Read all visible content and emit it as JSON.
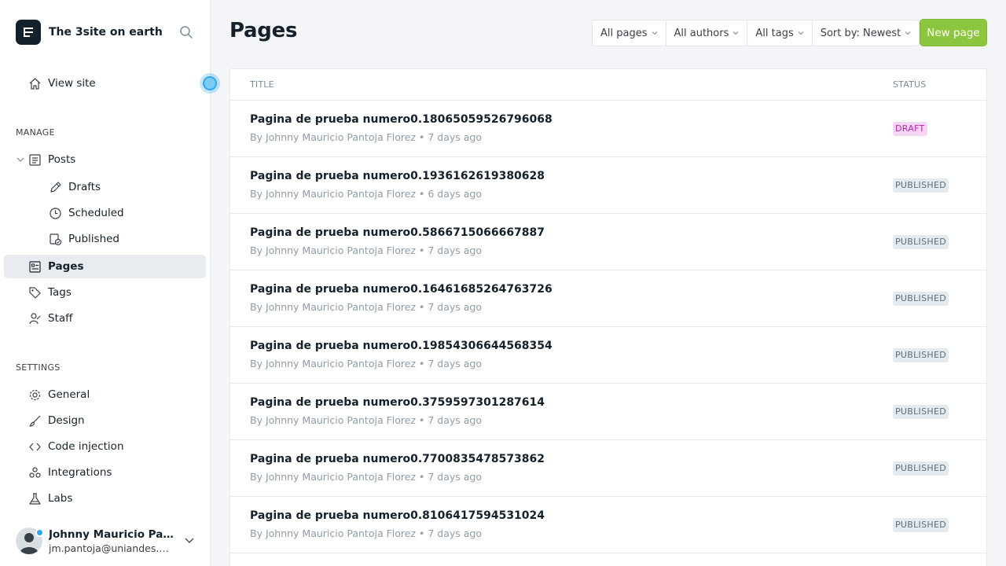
{
  "brand": {
    "title": "The 3site on earth",
    "logo_icon": "ghost-logo-icon"
  },
  "nav": {
    "view_site": "View site",
    "manage_title": "MANAGE",
    "posts": "Posts",
    "drafts": "Drafts",
    "scheduled": "Scheduled",
    "published": "Published",
    "pages": "Pages",
    "tags": "Tags",
    "staff": "Staff",
    "settings_title": "SETTINGS",
    "general": "General",
    "design": "Design",
    "code_injection": "Code injection",
    "integrations": "Integrations",
    "labs": "Labs"
  },
  "user": {
    "name": "Johnny Mauricio Pan...",
    "email": "jm.pantoja@uniandes.ed..."
  },
  "main": {
    "title": "Pages",
    "filters": {
      "type": "All pages",
      "authors": "All authors",
      "tags": "All tags",
      "sort": "Sort by: Newest"
    },
    "new_button": "New page",
    "columns": {
      "title": "TITLE",
      "status": "STATUS"
    },
    "rows": [
      {
        "title": "Pagina de prueba numero0.18065059526796068",
        "author": "Johnny Mauricio Pantoja Florez",
        "time": "7 days ago",
        "status": "DRAFT"
      },
      {
        "title": "Pagina de prueba numero0.1936162619380628",
        "author": "Johnny Mauricio Pantoja Florez",
        "time": "6 days ago",
        "status": "PUBLISHED"
      },
      {
        "title": "Pagina de prueba numero0.5866715066667887",
        "author": "Johnny Mauricio Pantoja Florez",
        "time": "7 days ago",
        "status": "PUBLISHED"
      },
      {
        "title": "Pagina de prueba numero0.16461685264763726",
        "author": "Johnny Mauricio Pantoja Florez",
        "time": "7 days ago",
        "status": "PUBLISHED"
      },
      {
        "title": "Pagina de prueba numero0.19854306644568354",
        "author": "Johnny Mauricio Pantoja Florez",
        "time": "7 days ago",
        "status": "PUBLISHED"
      },
      {
        "title": "Pagina de prueba numero0.3759597301287614",
        "author": "Johnny Mauricio Pantoja Florez",
        "time": "7 days ago",
        "status": "PUBLISHED"
      },
      {
        "title": "Pagina de prueba numero0.7700835478573862",
        "author": "Johnny Mauricio Pantoja Florez",
        "time": "7 days ago",
        "status": "PUBLISHED"
      },
      {
        "title": "Pagina de prueba numero0.8106417594531024",
        "author": "Johnny Mauricio Pantoja Florez",
        "time": "7 days ago",
        "status": "PUBLISHED"
      }
    ]
  },
  "colors": {
    "accent_green": "#8cc63f",
    "draft_bg": "#f5d6f3",
    "draft_text": "#c222bd",
    "published_bg": "#e5eaef",
    "published_text": "#5d6e7e",
    "sidebar_active": "#e8ecf1"
  }
}
